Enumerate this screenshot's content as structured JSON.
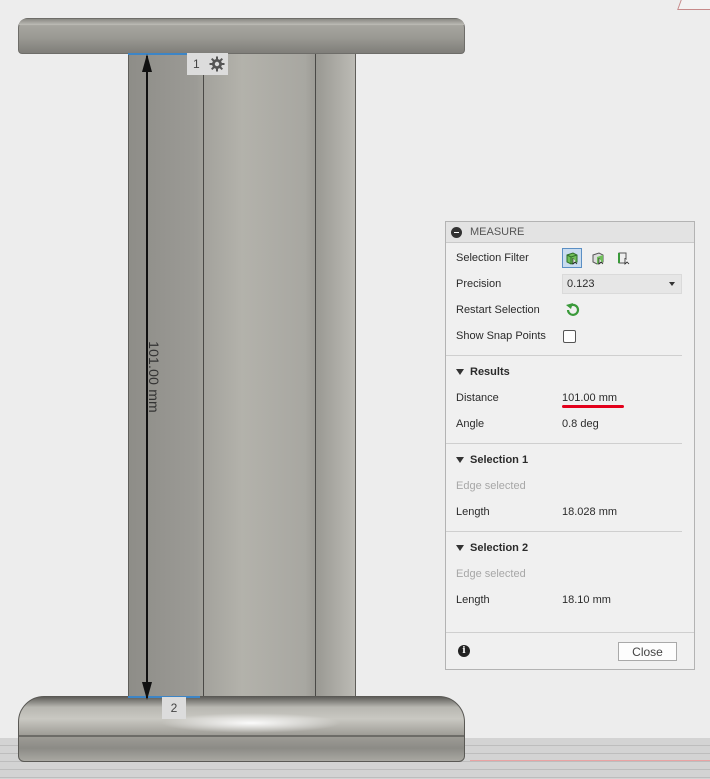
{
  "viewport": {
    "dimension_label": "101.00 mm",
    "marker_1": "1",
    "marker_2": "2"
  },
  "measure_panel": {
    "title": "MEASURE",
    "selection_filter_label": "Selection Filter",
    "precision_label": "Precision",
    "precision_value": "0.123",
    "restart_selection_label": "Restart Selection",
    "show_snap_points_label": "Show Snap Points",
    "results": {
      "heading": "Results",
      "distance_label": "Distance",
      "distance_value": "101.00 mm",
      "angle_label": "Angle",
      "angle_value": "0.8 deg"
    },
    "selection_1": {
      "heading": "Selection 1",
      "type": "Edge selected",
      "length_label": "Length",
      "length_value": "18.028 mm"
    },
    "selection_2": {
      "heading": "Selection 2",
      "type": "Edge selected",
      "length_label": "Length",
      "length_value": "18.10 mm"
    },
    "close_label": "Close"
  },
  "icons": {
    "gear": "gear-icon",
    "filter_body": "select-body-icon",
    "filter_face": "select-face-icon",
    "filter_edge": "select-edge-icon",
    "restart": "restart-arrow-icon",
    "info": "info-icon"
  },
  "colors": {
    "highlight_edge": "#3d85c6",
    "annotation_underline": "#e3001b",
    "restart_icon": "#3a9a3a"
  }
}
